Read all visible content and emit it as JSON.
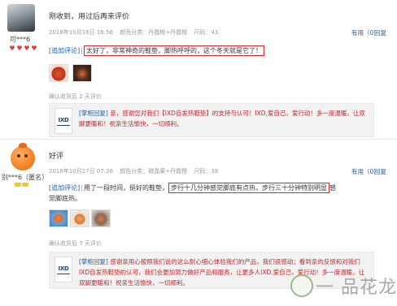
{
  "reviews": [
    {
      "user": "可***6",
      "title": "刚收到，用过后再来评价",
      "date": "2018年10月16日 16:56",
      "color": "颜色分类：丹霞橙+丹霞橙",
      "size": "尺码：43",
      "useful_label": "有用（0）",
      "reply_label": "回复",
      "append_tag": "[追加评论]",
      "append_text": "太好了，非常神奇的鞋垫，脚热呼呼的，这个冬天就是它了！",
      "purchased": "确认收货后 2 天评价",
      "shop_reply": {
        "tag": "[掌柜回复]",
        "text": "亲，感谢您对我们【IXD自发热鞋垫】的支持与认可！IXD,爱自己，爱行动！多一度温暖，让双脚更暖和！祝亲生活愉快，一切顺利。"
      }
    },
    {
      "user": "别***6（匿名）",
      "title": "好评",
      "date": "2018年10月27日 07:26",
      "color": "颜色分类：碳晶果+丹霞橙",
      "size": "尺码：38",
      "useful_label": "有用（0）",
      "reply_label": "回复",
      "append_tag": "[追加评论]",
      "append_pre": "用了一段时间，挺好的鞋垫，",
      "append_highlight": "步行十几分钟感觉脚底有点热，步行三十分钟特别明显",
      "append_post": "感",
      "append_line2": "觉脚底热。",
      "purchased": "确认收货后 7 天评价",
      "shop_reply": {
        "tag": "[掌柜回复]",
        "text": "感谢亲用心按照我们说的这么耐心细心体验我们的产品，我们很感动；看到亲的反馈和对我们IXD自发热鞋垫的认可，我们会更加努力做好产品和服务，让更多人IXD.爱自己，爱行动！多一度温暖，让双脚更暖和！祝亲生活愉快，一切顺利。"
      }
    }
  ],
  "shop_logo_text": "IXD",
  "watermark": "一 品花龙网",
  "icons": {
    "heart": "heart-icon",
    "crown": "crown-icon"
  },
  "colors": {
    "highlight_border": "#d9252b",
    "link_blue": "#2b5d9b",
    "reply_red": "#c0272d"
  }
}
